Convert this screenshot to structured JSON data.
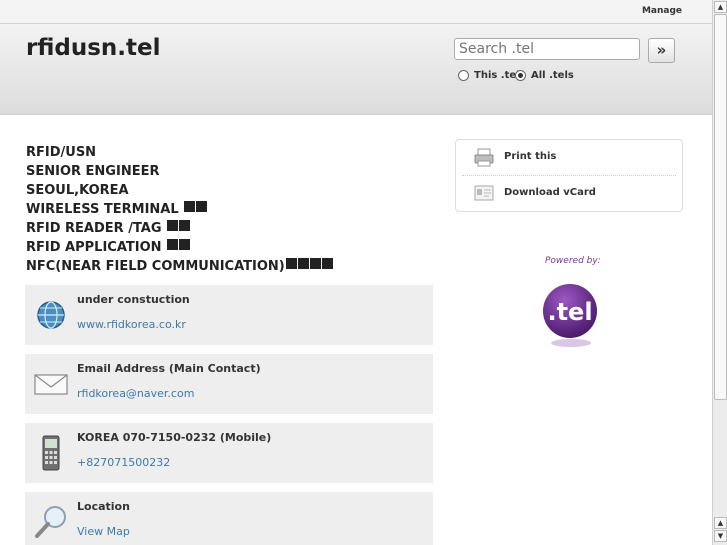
{
  "topbar": {
    "manage_label": "Manage"
  },
  "header": {
    "title": "rfidusn.tel",
    "search_placeholder": "Search .tel",
    "search_button_glyph": "»",
    "scope_this": "This .tel",
    "scope_all": "All .tels",
    "scope_selected": "All .tels"
  },
  "profile": {
    "lines": [
      {
        "text": "RFID/USN",
        "squares": 0
      },
      {
        "text": "SENIOR ENGINEER",
        "squares": 0
      },
      {
        "text": "SEOUL,KOREA",
        "squares": 0
      },
      {
        "text": "WIRELESS TERMINAL ",
        "squares": 2
      },
      {
        "text": "RFID READER /TAG ",
        "squares": 2
      },
      {
        "text": "RFID APPLICATION ",
        "squares": 2
      },
      {
        "text": "NFC(NEAR FIELD COMMUNICATION)",
        "squares": 4
      }
    ]
  },
  "cards": [
    {
      "title": "under constuction",
      "link": "www.rfidkorea.co.kr",
      "icon": "globe-icon"
    },
    {
      "title": "Email Address (Main Contact)",
      "link": "rfidkorea@naver.com",
      "icon": "envelope-icon"
    },
    {
      "title": "KOREA 070-7150-0232 (Mobile)",
      "link": "+827071500232",
      "icon": "mobile-phone-icon"
    },
    {
      "title": "Location",
      "link": "View Map",
      "icon": "magnifier-icon"
    }
  ],
  "actions": {
    "print_label": "Print this",
    "vcard_label": "Download vCard"
  },
  "powered": {
    "label": "Powered by:",
    "logo_text": ".tel"
  },
  "colors": {
    "link": "#3d7aa8",
    "brand_purple": "#6a2c8a",
    "powered_text": "#7a3a96"
  }
}
